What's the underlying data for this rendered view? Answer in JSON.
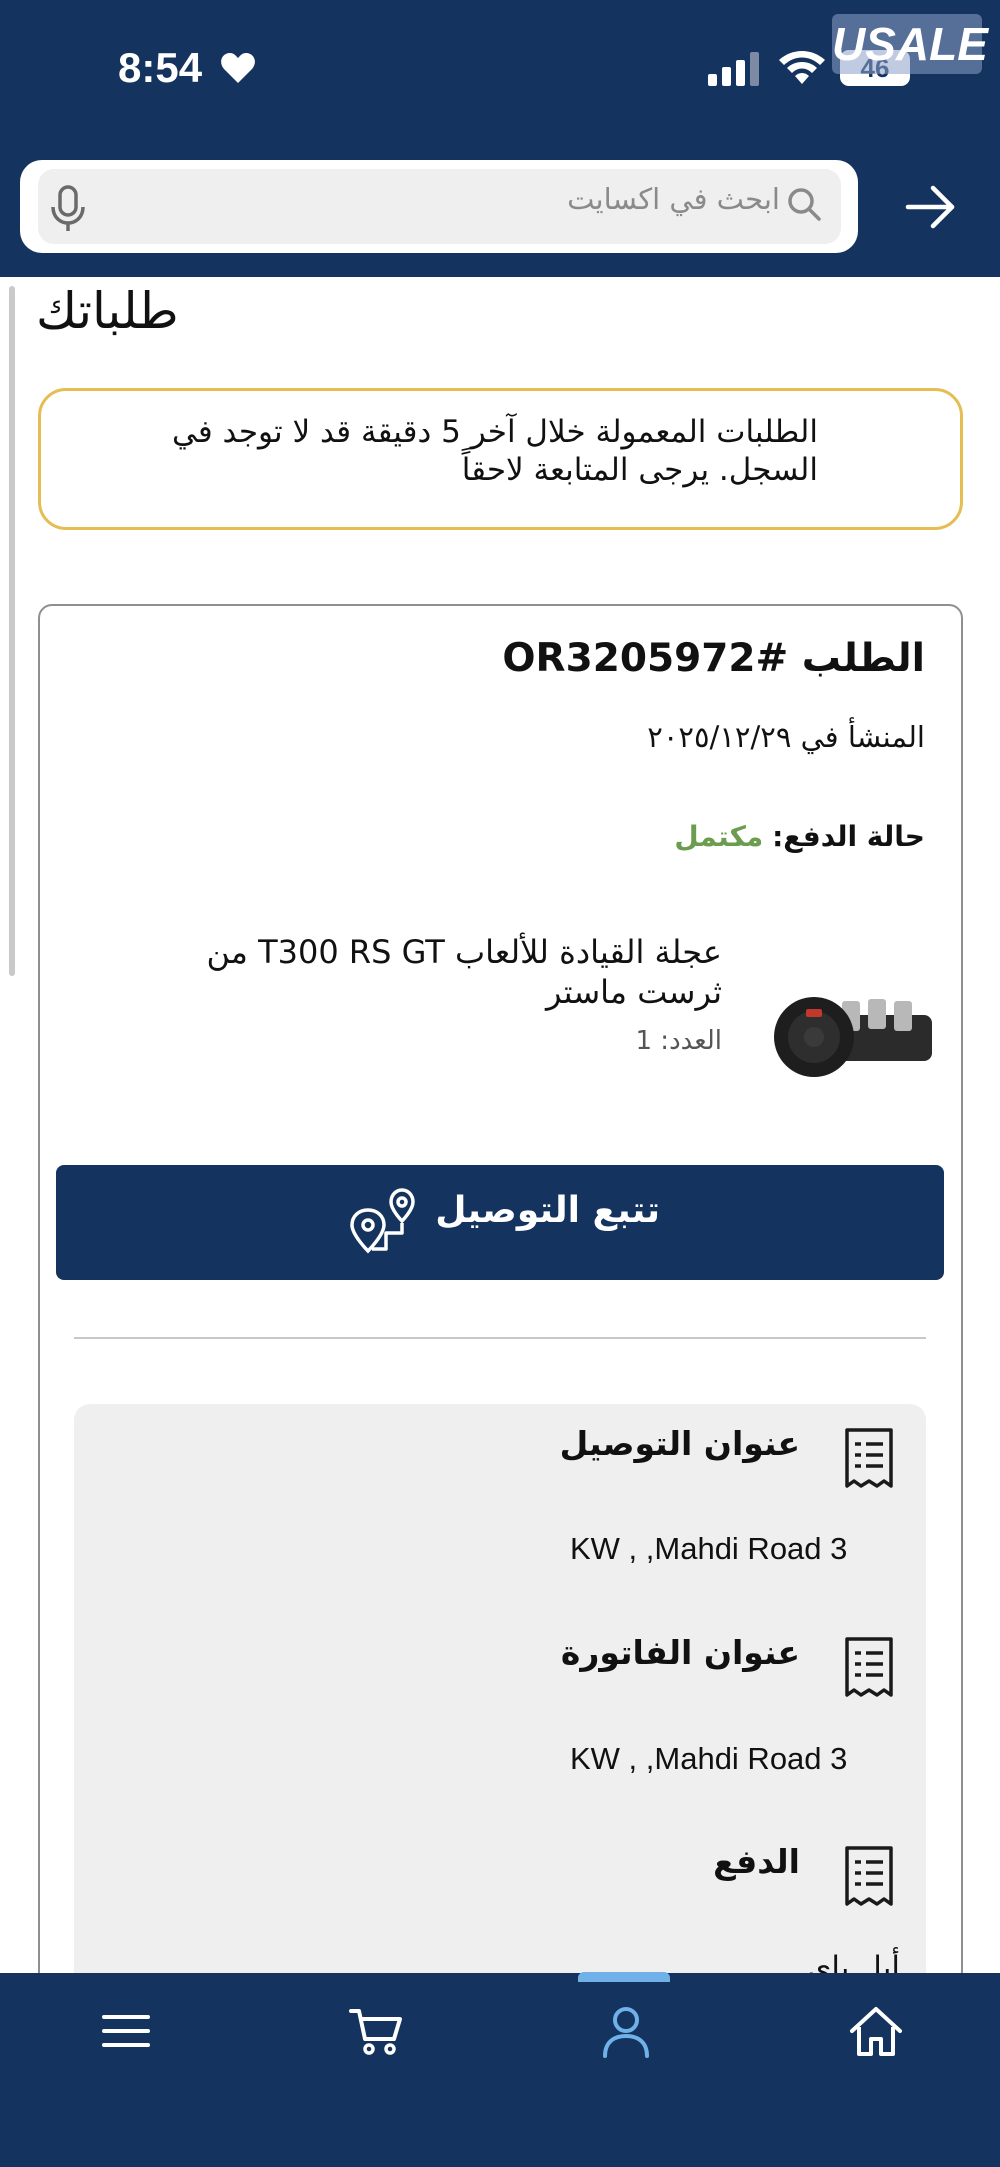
{
  "status_bar": {
    "time": "8:54",
    "battery": "46",
    "watermark": "USALE"
  },
  "search": {
    "placeholder": "ابحث في اكسايت"
  },
  "page": {
    "title": "طلباتك"
  },
  "notice": {
    "text": "الطلبات المعمولة خلال آخر 5 دقيقة قد لا توجد في السجل. يرجى المتابعة لاحقاً"
  },
  "order": {
    "title": "الطلب #OR3205972",
    "created": "المنشأ في ٢٠٢٥/١٢/٢٩",
    "payment_label": "حالة الدفع:",
    "payment_value": "مكتمل",
    "product": {
      "name": "عجلة القيادة للألعاب T300 RS GT من ثرست ماستر",
      "qty": "العدد: 1"
    },
    "track_label": "تتبع التوصيل"
  },
  "addresses": {
    "shipping_title": "عنوان التوصيل",
    "shipping_value": "KW ,       ,Mahdi Road 3",
    "billing_title": "عنوان الفاتورة",
    "billing_value": "KW ,       ,Mahdi Road 3",
    "payment_title": "الدفع",
    "payment_value": "أبل باي"
  },
  "nav": {
    "items": [
      "menu-icon",
      "cart-icon",
      "account-icon",
      "home-icon"
    ],
    "active": "account-icon"
  },
  "colors": {
    "brand_navy": "#14335e",
    "notice_border": "#e5bd53",
    "status_paid": "#6b9c4f",
    "nav_active": "#6fb1e8"
  }
}
